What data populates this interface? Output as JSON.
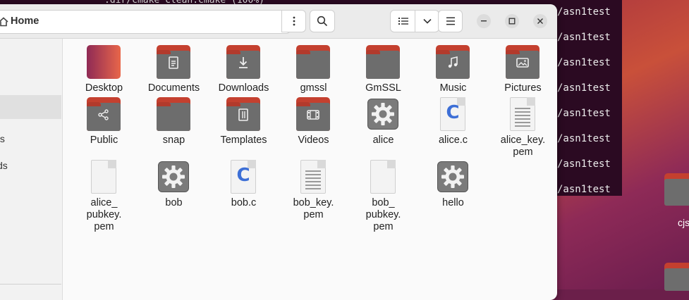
{
  "terminal": {
    "top_text": ".dir/cmake_clean.cmake (100%)",
    "lines": [
      "/asn1test",
      "/asn1test",
      "/asn1test",
      "/asn1test",
      "/asn1test",
      "/asn1test",
      "/asn1test",
      "/asn1test"
    ]
  },
  "desktop": {
    "folder_label": "cjs"
  },
  "window": {
    "path_label": "Home",
    "sidebar": {
      "items": [
        "ts",
        "ds"
      ]
    }
  },
  "files": [
    {
      "name": "Desktop",
      "icon": "desktop-folder-icon"
    },
    {
      "name": "Documents",
      "icon": "documents-folder-icon"
    },
    {
      "name": "Downloads",
      "icon": "downloads-folder-icon"
    },
    {
      "name": "gmssl",
      "icon": "folder-icon"
    },
    {
      "name": "GmSSL",
      "icon": "folder-icon"
    },
    {
      "name": "Music",
      "icon": "music-folder-icon"
    },
    {
      "name": "Pictures",
      "icon": "pictures-folder-icon"
    },
    {
      "name": "Public",
      "icon": "public-folder-icon"
    },
    {
      "name": "snap",
      "icon": "folder-icon"
    },
    {
      "name": "Templates",
      "icon": "templates-folder-icon"
    },
    {
      "name": "Videos",
      "icon": "videos-folder-icon"
    },
    {
      "name": "alice",
      "icon": "executable-icon"
    },
    {
      "name": "alice.c",
      "icon": "c-source-icon"
    },
    {
      "name": "alice_key.\npem",
      "icon": "text-file-icon"
    },
    {
      "name": "alice_\npubkey.\npem",
      "icon": "blank-file-icon"
    },
    {
      "name": "bob",
      "icon": "executable-icon"
    },
    {
      "name": "bob.c",
      "icon": "c-source-icon"
    },
    {
      "name": "bob_key.\npem",
      "icon": "text-file-icon"
    },
    {
      "name": "bob_\npubkey.\npem",
      "icon": "blank-file-icon"
    },
    {
      "name": "hello",
      "icon": "executable-icon"
    }
  ],
  "colors": {
    "folder_accent": "#c4402f",
    "folder_body": "#6d6d6d",
    "c_letter": "#3d6fd6"
  }
}
